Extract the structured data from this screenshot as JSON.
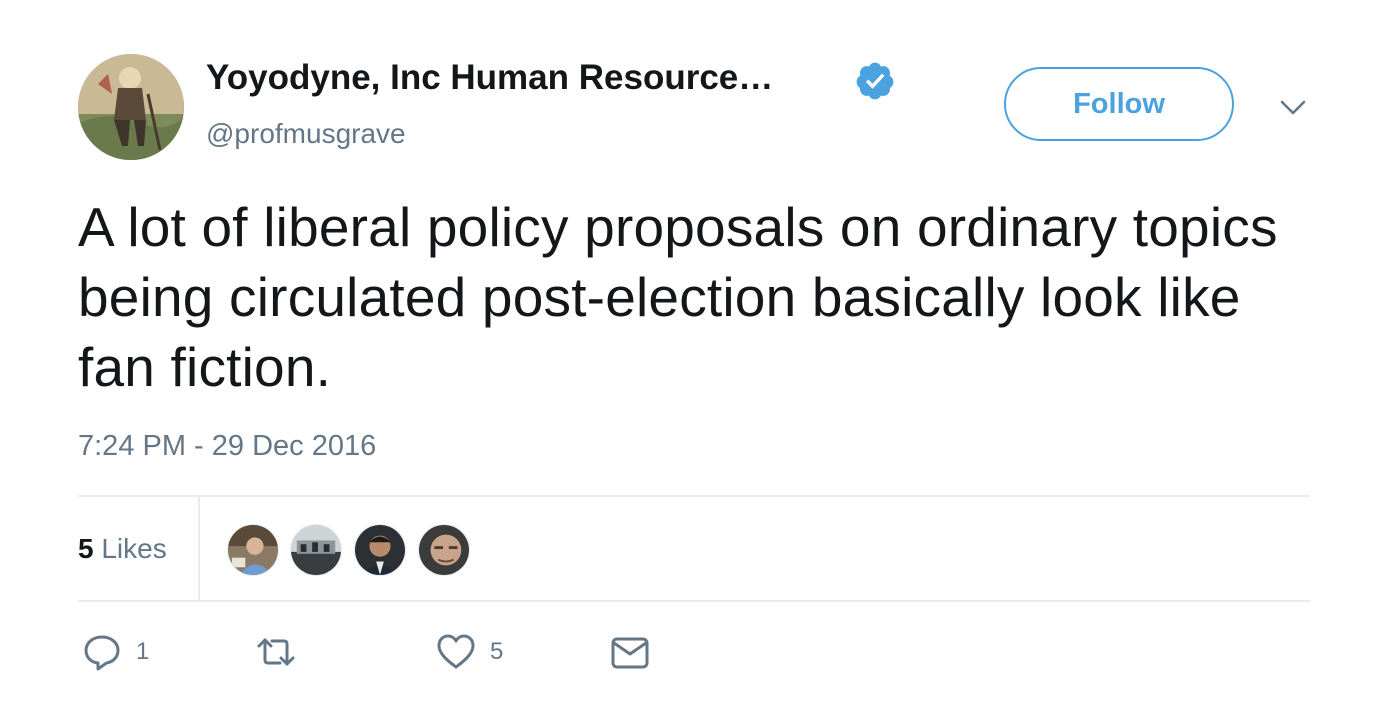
{
  "tweet": {
    "display_name": "Yoyodyne, Inc Human Resource…",
    "handle": "@profmusgrave",
    "verified_icon": "verified-badge-icon",
    "follow_label": "Follow",
    "text": "A lot of liberal policy proposals on ordinary topics being circulated post-election basically look like fan fiction.",
    "timestamp": "7:24 PM - 29 Dec 2016"
  },
  "stats": {
    "likes_count": "5",
    "likes_label": "Likes",
    "likers": [
      "liker-avatar-1",
      "liker-avatar-2",
      "liker-avatar-3",
      "liker-avatar-4"
    ]
  },
  "actions": {
    "reply_count": "1",
    "retweet_count": "",
    "like_count": "5"
  },
  "colors": {
    "accent": "#4aa3df",
    "text": "#14171a",
    "muted": "#657786",
    "divider": "#e6ecf0"
  }
}
